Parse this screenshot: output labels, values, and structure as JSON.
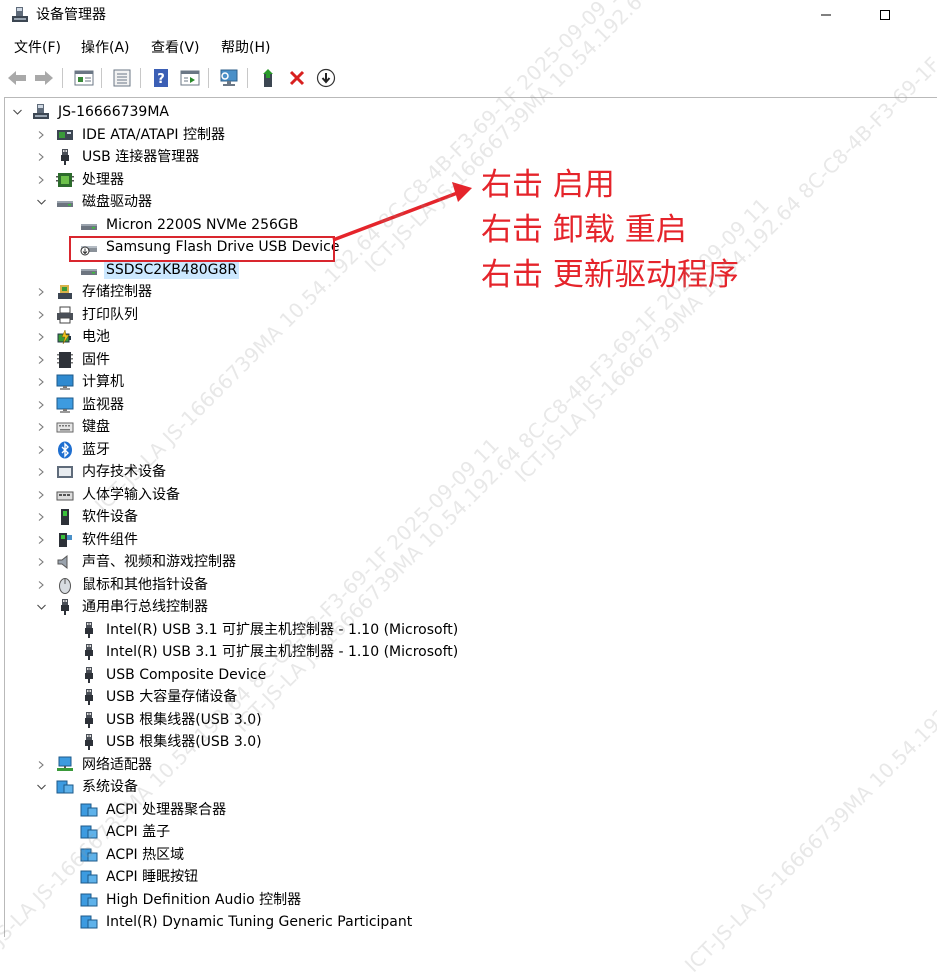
{
  "window": {
    "title": "设备管理器"
  },
  "menu": [
    "文件(F)",
    "操作(A)",
    "查看(V)",
    "帮助(H)"
  ],
  "toolbar": [
    {
      "name": "back-icon"
    },
    {
      "name": "forward-icon"
    },
    {
      "name": "properties-icon"
    },
    {
      "name": "list-view-icon"
    },
    {
      "name": "help-icon"
    },
    {
      "name": "run-icon"
    },
    {
      "name": "scan-hardware-icon"
    },
    {
      "name": "add-driver-icon"
    },
    {
      "name": "uninstall-icon"
    },
    {
      "name": "download-icon"
    }
  ],
  "tree": {
    "root": "JS-16666739MA",
    "items": [
      {
        "label": "IDE ATA/ATAPI 控制器",
        "icon": "ide-controller-icon",
        "level": 1,
        "state": "collapsed"
      },
      {
        "label": "USB 连接器管理器",
        "icon": "usb-plug-icon",
        "level": 1,
        "state": "collapsed"
      },
      {
        "label": "处理器",
        "icon": "processor-icon",
        "level": 1,
        "state": "collapsed"
      },
      {
        "label": "磁盘驱动器",
        "icon": "disk-drive-icon",
        "level": 1,
        "state": "expanded"
      },
      {
        "label": "Micron 2200S NVMe 256GB",
        "icon": "disk-drive-icon",
        "level": 2
      },
      {
        "label": "Samsung Flash Drive USB Device",
        "icon": "usb-disk-icon",
        "level": 2,
        "highlighted": true
      },
      {
        "label": "SSDSC2KB480G8R",
        "icon": "disk-drive-icon",
        "level": 2,
        "selected": true
      },
      {
        "label": "存储控制器",
        "icon": "storage-controller-icon",
        "level": 1,
        "state": "collapsed"
      },
      {
        "label": "打印队列",
        "icon": "printer-icon",
        "level": 1,
        "state": "collapsed"
      },
      {
        "label": "电池",
        "icon": "battery-icon",
        "level": 1,
        "state": "collapsed"
      },
      {
        "label": "固件",
        "icon": "firmware-icon",
        "level": 1,
        "state": "collapsed"
      },
      {
        "label": "计算机",
        "icon": "computer-icon",
        "level": 1,
        "state": "collapsed"
      },
      {
        "label": "监视器",
        "icon": "monitor-icon",
        "level": 1,
        "state": "collapsed"
      },
      {
        "label": "键盘",
        "icon": "keyboard-icon",
        "level": 1,
        "state": "collapsed"
      },
      {
        "label": "蓝牙",
        "icon": "bluetooth-icon",
        "level": 1,
        "state": "collapsed"
      },
      {
        "label": "内存技术设备",
        "icon": "memory-icon",
        "level": 1,
        "state": "collapsed"
      },
      {
        "label": "人体学输入设备",
        "icon": "hid-icon",
        "level": 1,
        "state": "collapsed"
      },
      {
        "label": "软件设备",
        "icon": "software-device-icon",
        "level": 1,
        "state": "collapsed"
      },
      {
        "label": "软件组件",
        "icon": "software-component-icon",
        "level": 1,
        "state": "collapsed"
      },
      {
        "label": "声音、视频和游戏控制器",
        "icon": "speaker-icon",
        "level": 1,
        "state": "collapsed"
      },
      {
        "label": "鼠标和其他指针设备",
        "icon": "mouse-icon",
        "level": 1,
        "state": "collapsed"
      },
      {
        "label": "通用串行总线控制器",
        "icon": "usb-plug-icon",
        "level": 1,
        "state": "expanded"
      },
      {
        "label": "Intel(R) USB 3.1 可扩展主机控制器 - 1.10 (Microsoft)",
        "icon": "usb-plug-icon",
        "level": 2
      },
      {
        "label": "Intel(R) USB 3.1 可扩展主机控制器 - 1.10 (Microsoft)",
        "icon": "usb-plug-icon",
        "level": 2
      },
      {
        "label": "USB Composite Device",
        "icon": "usb-plug-icon",
        "level": 2
      },
      {
        "label": "USB 大容量存储设备",
        "icon": "usb-plug-icon",
        "level": 2
      },
      {
        "label": "USB 根集线器(USB 3.0)",
        "icon": "usb-plug-icon",
        "level": 2
      },
      {
        "label": "USB 根集线器(USB 3.0)",
        "icon": "usb-plug-icon",
        "level": 2
      },
      {
        "label": "网络适配器",
        "icon": "network-adapter-icon",
        "level": 1,
        "state": "collapsed"
      },
      {
        "label": "系统设备",
        "icon": "system-device-icon",
        "level": 1,
        "state": "expanded"
      },
      {
        "label": "ACPI 处理器聚合器",
        "icon": "system-device-icon",
        "level": 2
      },
      {
        "label": "ACPI 盖子",
        "icon": "system-device-icon",
        "level": 2
      },
      {
        "label": "ACPI 热区域",
        "icon": "system-device-icon",
        "level": 2
      },
      {
        "label": "ACPI 睡眠按钮",
        "icon": "system-device-icon",
        "level": 2
      },
      {
        "label": "High Definition Audio 控制器",
        "icon": "system-device-icon",
        "level": 2
      },
      {
        "label": "Intel(R) Dynamic Tuning Generic Participant",
        "icon": "system-device-icon",
        "level": 2
      }
    ]
  },
  "annotation": {
    "lines": [
      "右击 启用",
      "右击 卸载 重启",
      "右击 更新驱动程序"
    ],
    "color": "#e5242b"
  },
  "watermarks": [
    "ICT-JS-LA JS-16666739MA 10.54.192.64 8C-C8-4B-F3-69-1F 2025-09-09 11"
  ]
}
